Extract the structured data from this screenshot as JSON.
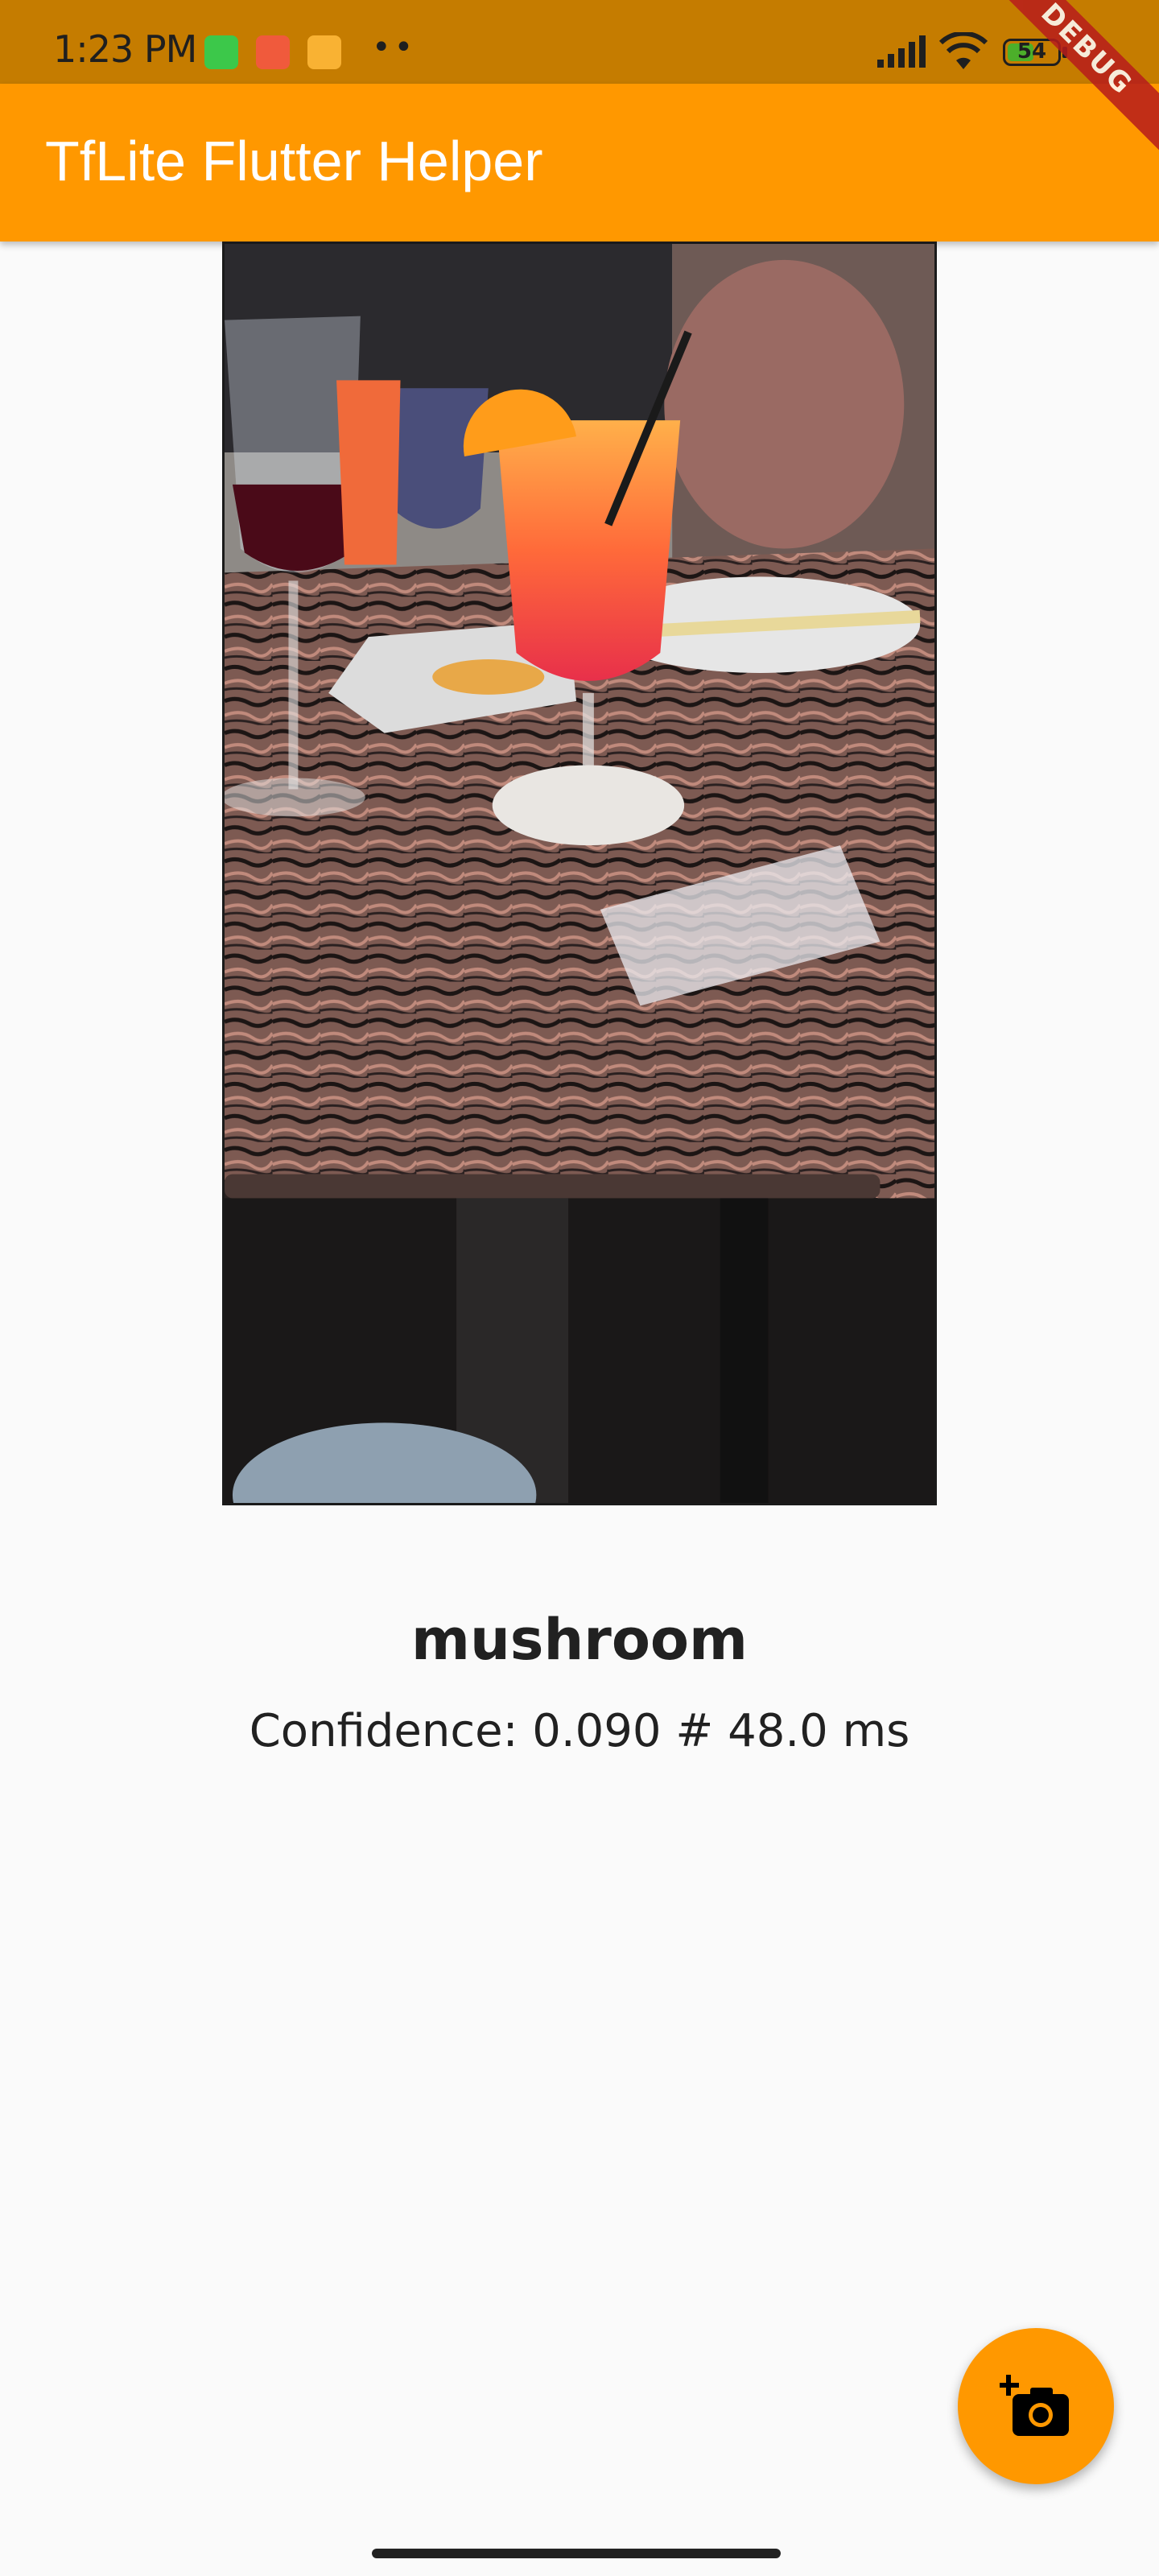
{
  "status_bar": {
    "time": "1:23 PM",
    "battery_level": "54",
    "battery_fraction": 0.54,
    "icons": [
      "app-notification-green-icon",
      "app-notification-red-icon",
      "app-notification-yellow-icon",
      "more-notifications-icon",
      "signal-icon",
      "wifi-icon",
      "battery-icon"
    ]
  },
  "debug_banner": {
    "text": "DEBUG"
  },
  "app_bar": {
    "title": "TfLite Flutter Helper",
    "color": "#ff9800"
  },
  "image": {
    "description_icon": "photo-image"
  },
  "result": {
    "label": "mushroom",
    "confidence_text": "Confidence: 0.090 # 48.0 ms"
  },
  "fab": {
    "icon": "add-a-photo-icon",
    "color": "#ff9800"
  }
}
